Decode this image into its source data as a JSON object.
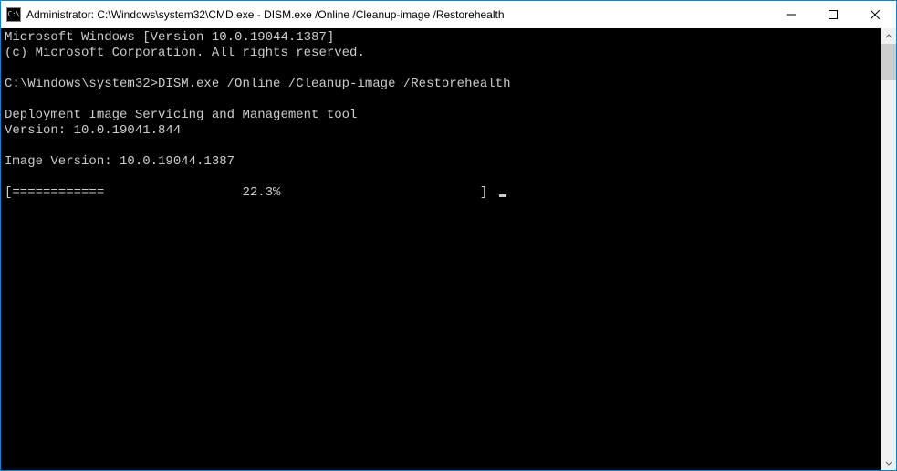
{
  "titlebar": {
    "icon_text": "C:\\",
    "title": "Administrator: C:\\Windows\\system32\\CMD.exe - DISM.exe  /Online /Cleanup-image /Restorehealth"
  },
  "console": {
    "line1": "Microsoft Windows [Version 10.0.19044.1387]",
    "line2": "(c) Microsoft Corporation. All rights reserved.",
    "blank1": "",
    "prompt_line": "C:\\Windows\\system32>DISM.exe /Online /Cleanup-image /Restorehealth",
    "blank2": "",
    "tool_line1": "Deployment Image Servicing and Management tool",
    "tool_line2": "Version: 10.0.19041.844",
    "blank3": "",
    "image_ver": "Image Version: 10.0.19044.1387",
    "blank4": "",
    "progress": "[============                  22.3%                          ] "
  }
}
